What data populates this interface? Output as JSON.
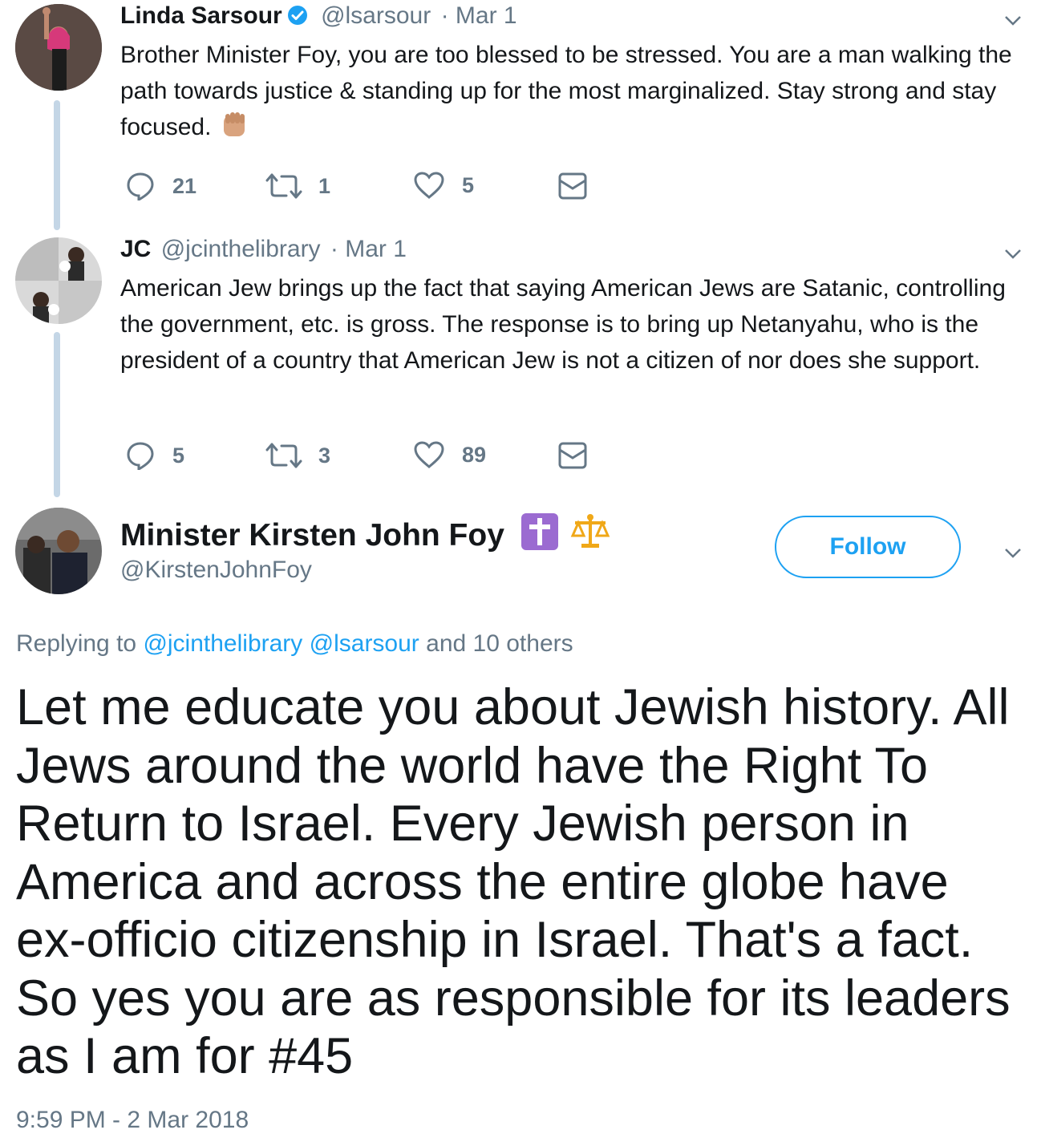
{
  "tweets": [
    {
      "name": "Linda Sarsour",
      "handle": "@lsarsour",
      "date": "· Mar 1",
      "text": "Brother Minister Foy, you are too blessed to be stressed. You are a man walking the path towards justice & standing up for the most marginalized. Stay strong and stay focused.",
      "emoji": "raised-fist-medium-skin-tone",
      "replies": "21",
      "retweets": "1",
      "likes": "5",
      "verified": true
    },
    {
      "name": "JC",
      "handle": "@jcinthelibrary",
      "date": "· Mar 1",
      "text": "American Jew brings up the fact that saying American Jews are Satanic, controlling the government, etc. is gross. The response is to bring up Netanyahu, who is the president of a country that American Jew is not a citizen of nor does she support.",
      "replies": "5",
      "retweets": "3",
      "likes": "89"
    }
  ],
  "main_tweet": {
    "name": "Minister Kirsten John Foy",
    "name_icons": [
      "latin-cross-icon",
      "balance-scale-icon"
    ],
    "handle": "@KirstenJohnFoy",
    "follow_label": "Follow",
    "replying_prefix": "Replying to",
    "replying_mentions": [
      "@jcinthelibrary",
      "@lsarsour"
    ],
    "replying_suffix": "and 10 others",
    "text": "Let me educate you about Jewish history. All Jews around the world have the Right To Return to Israel. Every Jewish person in America and across the entire globe have ex-officio citizenship in Israel. That's a fact. So yes you are as responsible for its leaders as I am for #45",
    "timestamp": "9:59 PM - 2 Mar 2018"
  },
  "colors": {
    "link": "#1da1f2",
    "secondary": "#657786",
    "thread_line": "#c4d6e6"
  }
}
